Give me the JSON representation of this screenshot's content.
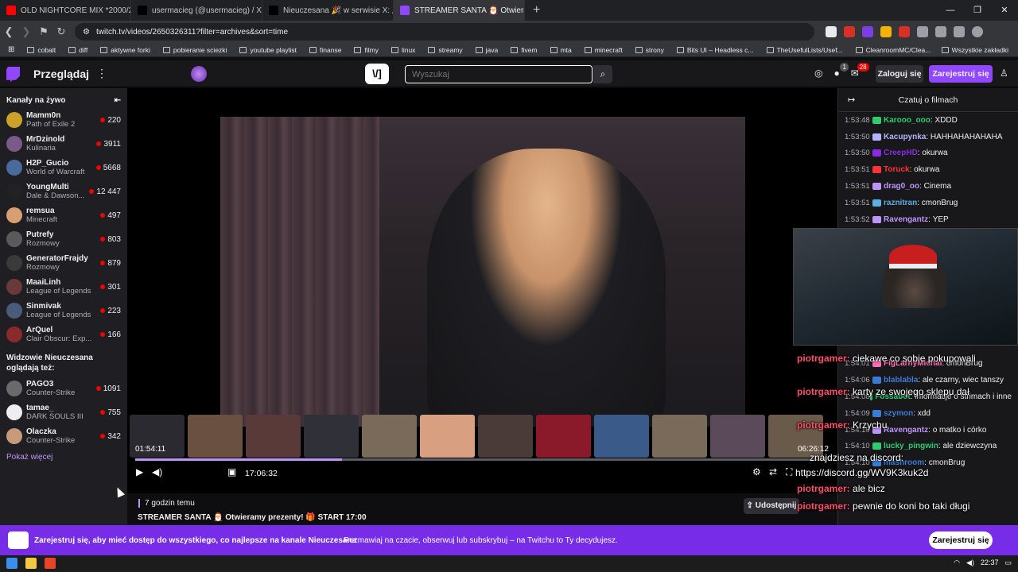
{
  "browser": {
    "tabs": [
      {
        "title": "OLD NIGHTCORE MIX *2000/201",
        "icon_color": "#ff0000",
        "active": false
      },
      {
        "title": "usermacieg (@usermacieg) / X",
        "icon_color": "#000000",
        "active": false
      },
      {
        "title": "Nieuczesana 🎉 w serwisie X: „STREA",
        "icon_color": "#000000",
        "active": false
      },
      {
        "title": "STREAMER SANTA 🎅 Otwieram",
        "icon_color": "#9147ff",
        "active": true
      }
    ],
    "url": "twitch.tv/videos/2650326311?filter=archives&sort=time",
    "bookmarks": [
      "cobalt",
      "diff",
      "aktywne forki",
      "pobieranie sciezki",
      "youtube playlist",
      "finanse",
      "filmy",
      "linux",
      "streamy",
      "java",
      "fivem",
      "mta",
      "minecraft",
      "strony",
      "Bits UI – Headless c...",
      "TheUsefulLists/Usef...",
      "CleanroomMC/Clea..."
    ],
    "bookmarks_all": "Wszystkie zakładki"
  },
  "twitch_nav": {
    "browse": "Przeglądaj",
    "search_placeholder": "Wyszukaj",
    "notifications_count": "1",
    "inbox_count": "28",
    "login": "Zaloguj się",
    "signup": "Zarejestruj się"
  },
  "sidebar": {
    "live_header": "Kanały na żywo",
    "live_channels": [
      {
        "name": "Mamm0n",
        "game": "Path of Exile 2",
        "viewers": "220",
        "color": "#c9a227"
      },
      {
        "name": "MrDzinold",
        "game": "Kulinaria",
        "viewers": "3911",
        "color": "#7a5a8a"
      },
      {
        "name": "H2P_Gucio",
        "game": "World of Warcraft",
        "viewers": "5668",
        "color": "#4a6a9a"
      },
      {
        "name": "YoungMulti",
        "game": "Dale & Dawson...",
        "viewers": "12 447",
        "color": "#222222"
      },
      {
        "name": "remsua",
        "game": "Minecraft",
        "viewers": "497",
        "color": "#d8a070"
      },
      {
        "name": "Putrefy",
        "game": "Rozmowy",
        "viewers": "803",
        "color": "#5a5a5a"
      },
      {
        "name": "GeneratorFrajdy",
        "game": "Rozmowy",
        "viewers": "879",
        "color": "#3a3a3a"
      },
      {
        "name": "MaaiLinh",
        "game": "League of Legends",
        "viewers": "301",
        "color": "#6a3a3a"
      },
      {
        "name": "Sinmivak",
        "game": "League of Legends",
        "viewers": "223",
        "color": "#4a5a7a"
      },
      {
        "name": "ArQuel",
        "game": "Clair Obscur: Exp...",
        "viewers": "166",
        "color": "#8a2a2a"
      }
    ],
    "also_header": "Widzowie Nieuczesana oglądają też:",
    "also_channels": [
      {
        "name": "PAGO3",
        "game": "Counter-Strike",
        "viewers": "1091",
        "color": "#6a6a6a"
      },
      {
        "name": "tamae_",
        "game": "DARK SOULS III",
        "viewers": "755",
        "color": "#eeeeee"
      },
      {
        "name": "Olaczka",
        "game": "Counter-Strike",
        "viewers": "342",
        "color": "#c89a7a"
      }
    ],
    "show_more": "Pokaż więcej"
  },
  "player": {
    "seek_thumb_time_left": "01:54:11",
    "seek_thumb_time_right": "06:26:12",
    "current_time": "17:06:32",
    "progress": 0.3,
    "thumb_colors": [
      "#2a2a30",
      "#6a5040",
      "#5a3a38",
      "#303038",
      "#7a6a5a",
      "#d8a080",
      "#4a3a38",
      "#8a1a2a",
      "#3a5a8a",
      "#7a6a5a",
      "#5a4a5a",
      "#6a5a4a"
    ]
  },
  "video_info": {
    "ago": "7 godzin temu",
    "title": "STREAMER SANTA 🎅 Otwieramy prezenty! 🎁 START 17:00",
    "share": "Udostępnij"
  },
  "chat": {
    "header": "Czatuj o filmach",
    "messages": [
      {
        "time": "1:53:48",
        "user": "Karooo_ooo",
        "text": "XDDD",
        "color": "#2ecc71"
      },
      {
        "time": "1:53:50",
        "user": "Kacupynka",
        "text": "HAHHAHAHAHAHA",
        "color": "#b5b5ff"
      },
      {
        "time": "1:53:50",
        "user": "CreepHD",
        "text": "okurwa",
        "color": "#8a2be2"
      },
      {
        "time": "1:53:51",
        "user": "Toruck",
        "text": "okurwa",
        "color": "#ff3333"
      },
      {
        "time": "1:53:51",
        "user": "drag0_oo",
        "text": "Cinema",
        "color": "#bf94ff"
      },
      {
        "time": "1:53:51",
        "user": "raznitran",
        "text": "cmonBrug",
        "color": "#5dade2"
      },
      {
        "time": "1:53:52",
        "user": "Ravengantz",
        "text": "YEP",
        "color": "#bf94ff"
      },
      {
        "time": "1:54:01",
        "user": "FigLarnyMichal",
        "text": "cmonBrug",
        "color": "#ff6fb5"
      },
      {
        "time": "1:54:06",
        "user": "blablabla",
        "text": "ale czarny, wiec tanszy",
        "color": "#3a7bd5"
      },
      {
        "time": "1:54:08",
        "user": "Fossabot",
        "text": "informacje o strimach i inne",
        "color": "#2ecc71"
      },
      {
        "time": "1:54:09",
        "user": "szymon",
        "text": "xdd",
        "color": "#3a7bd5"
      },
      {
        "time": "1:54:10",
        "user": "Ravengantz",
        "text": "o matko i córko",
        "color": "#bf94ff"
      },
      {
        "time": "1:54:10",
        "user": "lucky_pingwin",
        "text": "ale dziewczyna",
        "color": "#2ecc71"
      },
      {
        "time": "1:54:10",
        "user": "mashroom",
        "text": "cmonBrug",
        "color": "#3a7bd5"
      }
    ]
  },
  "overlay": {
    "lines": [
      {
        "name": "piotrgamer:",
        "text": "ciekawe co sobie pokupowali"
      },
      {
        "name": "piotrgamer:",
        "text": "karty ze swojego sklepu dał"
      },
      {
        "name": "piotrgamer:",
        "text": "Krzychu"
      },
      {
        "name": "",
        "text": "znajdziesz na discord:"
      },
      {
        "name": "",
        "text": "https://discord.gg/WV9K3kuk2d"
      },
      {
        "name": "piotrgamer:",
        "text": "ale bicz"
      },
      {
        "name": "piotrgamer:",
        "text": "pewnie do koni bo taki długi"
      }
    ]
  },
  "banner": {
    "main": "Zarejestruj się, aby mieć dostęp do wszystkiego, co najlepsze na kanale Nieuczesana",
    "sub": "Rozmawiaj na czacie, obserwuj lub subskrybuj – na Twitchu to Ty decydujesz.",
    "button": "Zarejestruj się"
  },
  "taskbar": {
    "time": "22:37"
  }
}
